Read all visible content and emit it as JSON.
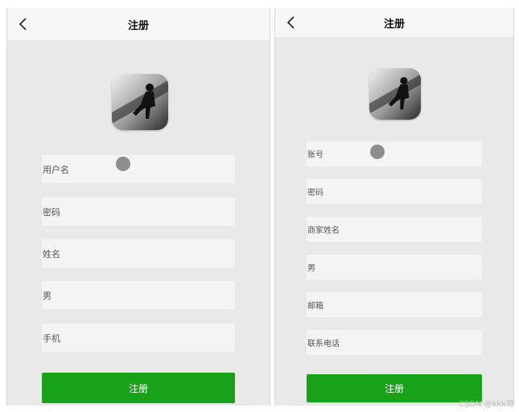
{
  "left_screen": {
    "title": "注册",
    "fields": [
      "用户名",
      "密码",
      "姓名",
      "男",
      "手机"
    ],
    "submit_label": "注册"
  },
  "right_screen": {
    "title": "注册",
    "fields": [
      "账号",
      "密码",
      "商家姓名",
      "男",
      "邮箱",
      "联系电话"
    ],
    "submit_label": "注册"
  },
  "watermark": "CSDN @kkk哥",
  "colors": {
    "accent": "#18a21a",
    "background": "#e9e9e9",
    "input": "#f4f4f4",
    "navbar": "#f7f7f7"
  },
  "icons": [
    "back-arrow-icon",
    "avatar-photo"
  ]
}
